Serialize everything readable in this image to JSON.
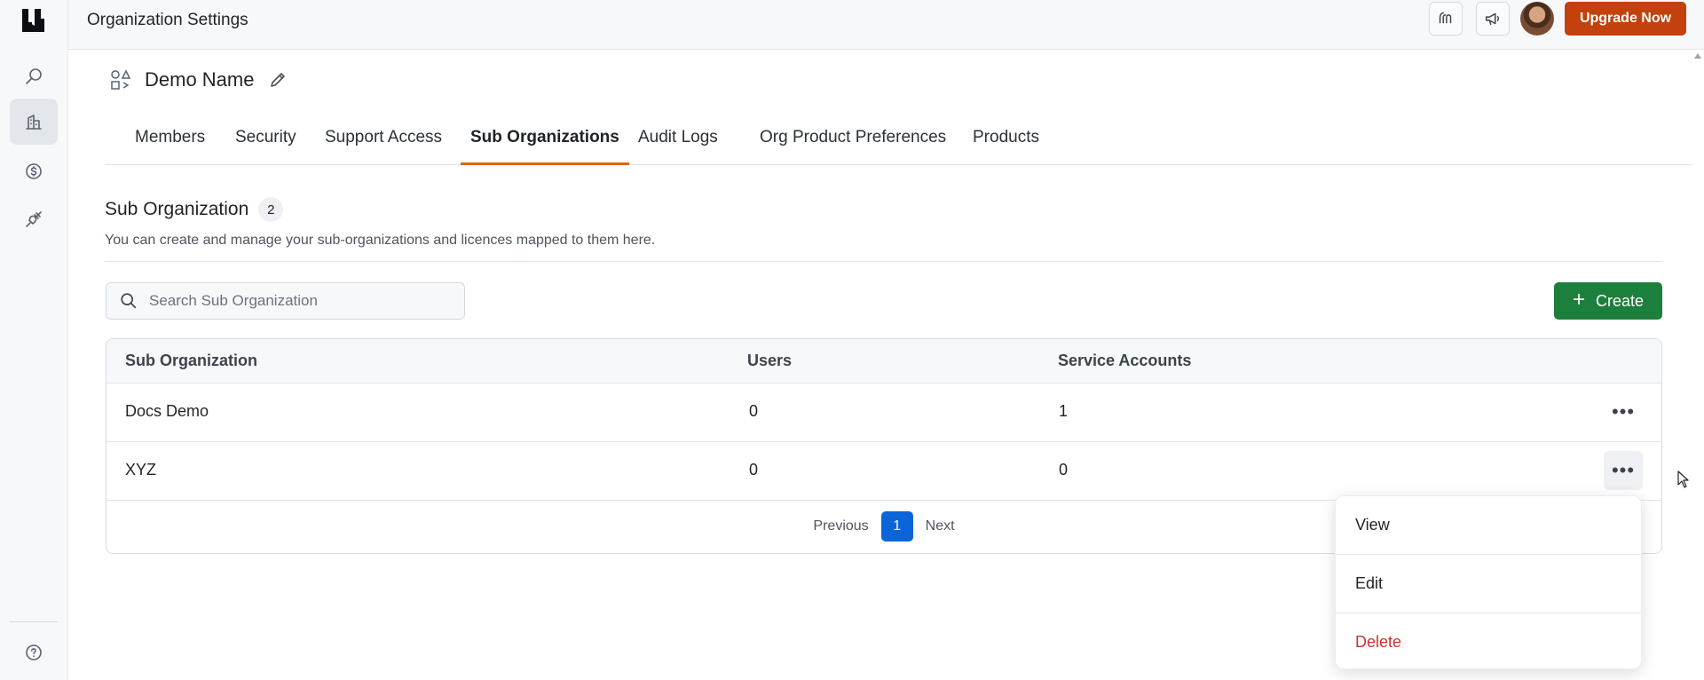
{
  "topbar": {
    "title": "Organization Settings",
    "upgrade_label": "Upgrade Now",
    "brand_color": "#c2410c"
  },
  "rail": {
    "items": [
      {
        "name": "search-icon",
        "active": false
      },
      {
        "name": "organization-icon",
        "active": true
      },
      {
        "name": "billing-icon",
        "active": false
      },
      {
        "name": "integrations-icon",
        "active": false
      }
    ],
    "help_icon": "help-icon"
  },
  "org": {
    "name": "Demo Name"
  },
  "tabs": [
    {
      "label": "Members"
    },
    {
      "label": "Security"
    },
    {
      "label": "Support Access"
    },
    {
      "label": "Sub Organizations",
      "active": true
    },
    {
      "label": "Audit Logs"
    },
    {
      "label": "Org Product Preferences"
    },
    {
      "label": "Products"
    }
  ],
  "section": {
    "title": "Sub Organization",
    "count": "2",
    "description": "You can create and manage your sub-organizations and licences mapped to them here."
  },
  "search": {
    "placeholder": "Search Sub Organization",
    "value": ""
  },
  "create": {
    "label": "Create",
    "color": "#1d7f3c"
  },
  "table": {
    "columns": [
      "Sub Organization",
      "Users",
      "Service Accounts"
    ],
    "rows": [
      {
        "name": "Docs Demo",
        "users": "0",
        "service_accounts": "1"
      },
      {
        "name": "XYZ",
        "users": "0",
        "service_accounts": "0"
      }
    ]
  },
  "pagination": {
    "previous": "Previous",
    "current": "1",
    "next": "Next"
  },
  "row_menu": {
    "items": [
      "View",
      "Edit",
      "Delete"
    ],
    "delete_color": "#c8332b"
  }
}
